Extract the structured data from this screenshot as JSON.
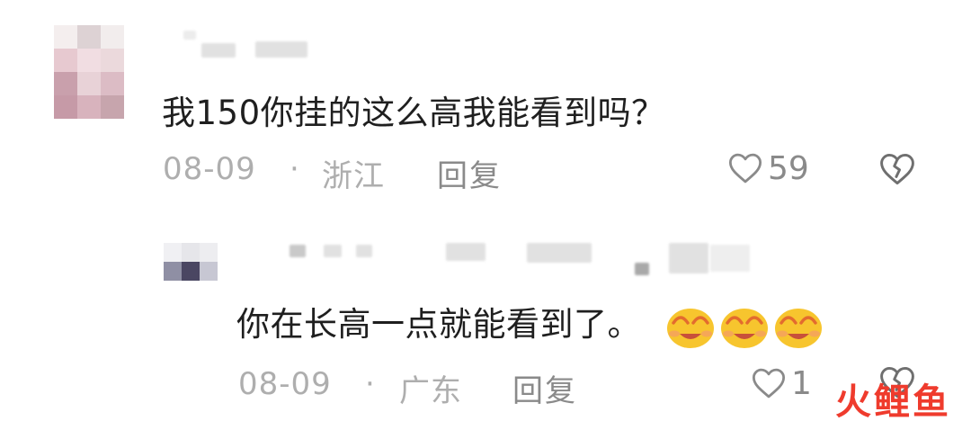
{
  "comment": {
    "text": "我150你挂的这么高我能看到吗？",
    "date": "08-09",
    "separator": "·",
    "location": "浙江",
    "reply_label": "回复",
    "like_count": "59"
  },
  "reply": {
    "text": "你在长高一点就能看到了。",
    "date": "08-09",
    "separator": "·",
    "location": "广东",
    "reply_label": "回复",
    "like_count": "1",
    "emojis": [
      "sweat-smile-emoji",
      "sweat-smile-emoji",
      "sweat-smile-emoji"
    ]
  },
  "watermark": "火鲤鱼",
  "colors": {
    "text": "#1f1f1f",
    "meta": "#aeaeae",
    "action": "#8a8a8a",
    "emoji": "#f7c52e",
    "watermark": "#ef3b2d"
  },
  "icons": [
    "heart-icon",
    "broken-heart-icon"
  ]
}
